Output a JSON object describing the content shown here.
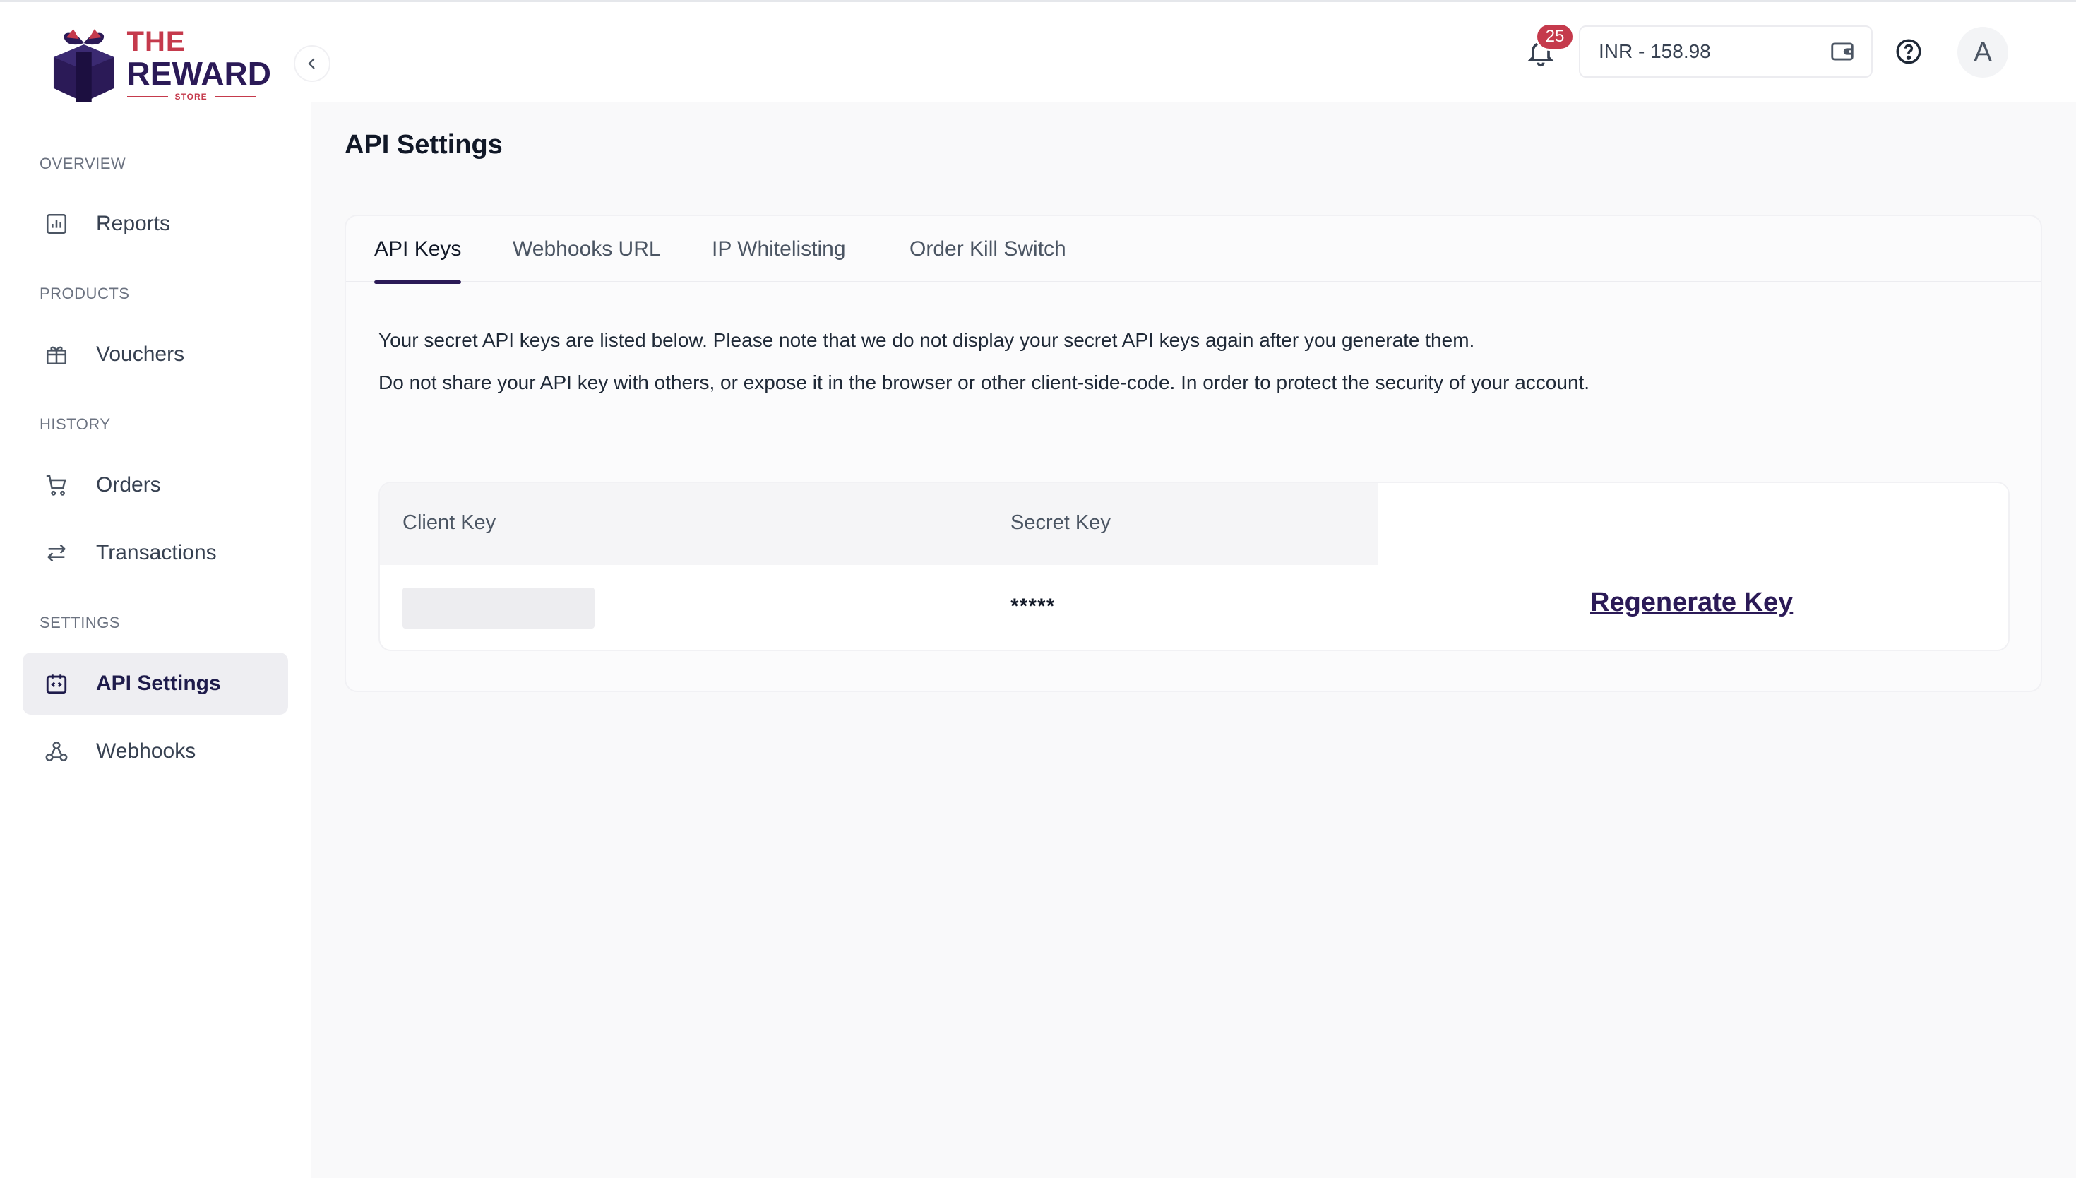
{
  "brand": {
    "line1": "THE",
    "line2": "REWARD",
    "line3": "STORE",
    "primary_color": "#2b1a57",
    "accent_color": "#c53a4c"
  },
  "sidebar": {
    "sections": [
      {
        "label": "OVERVIEW",
        "items": [
          {
            "label": "Reports",
            "icon": "bar-chart-icon",
            "active": false
          }
        ]
      },
      {
        "label": "PRODUCTS",
        "items": [
          {
            "label": "Vouchers",
            "icon": "gift-icon",
            "active": false
          }
        ]
      },
      {
        "label": "HISTORY",
        "items": [
          {
            "label": "Orders",
            "icon": "cart-icon",
            "active": false
          },
          {
            "label": "Transactions",
            "icon": "swap-arrows-icon",
            "active": false
          }
        ]
      },
      {
        "label": "SETTINGS",
        "items": [
          {
            "label": "API Settings",
            "icon": "code-calendar-icon",
            "active": true
          },
          {
            "label": "Webhooks",
            "icon": "webhook-icon",
            "active": false
          }
        ]
      }
    ]
  },
  "header": {
    "notification_count": "25",
    "balance": "INR - 158.98",
    "avatar_initial": "A"
  },
  "main": {
    "page_title": "API Settings",
    "tabs": [
      {
        "label": "API Keys",
        "active": true
      },
      {
        "label": "Webhooks URL",
        "active": false
      },
      {
        "label": "IP Whitelisting",
        "active": false
      },
      {
        "label": "Order Kill Switch",
        "active": false
      }
    ],
    "description": [
      "Your secret API keys are listed below. Please note that we do not display your secret API keys again after you generate them.",
      "Do not share your API key with others, or expose it in the browser or other client-side-code. In order to protect the security of your account."
    ],
    "keys_table": {
      "headers": [
        "Client Key",
        "Secret Key"
      ],
      "secret_value": "*****",
      "action_label": "Regenerate Key"
    }
  }
}
